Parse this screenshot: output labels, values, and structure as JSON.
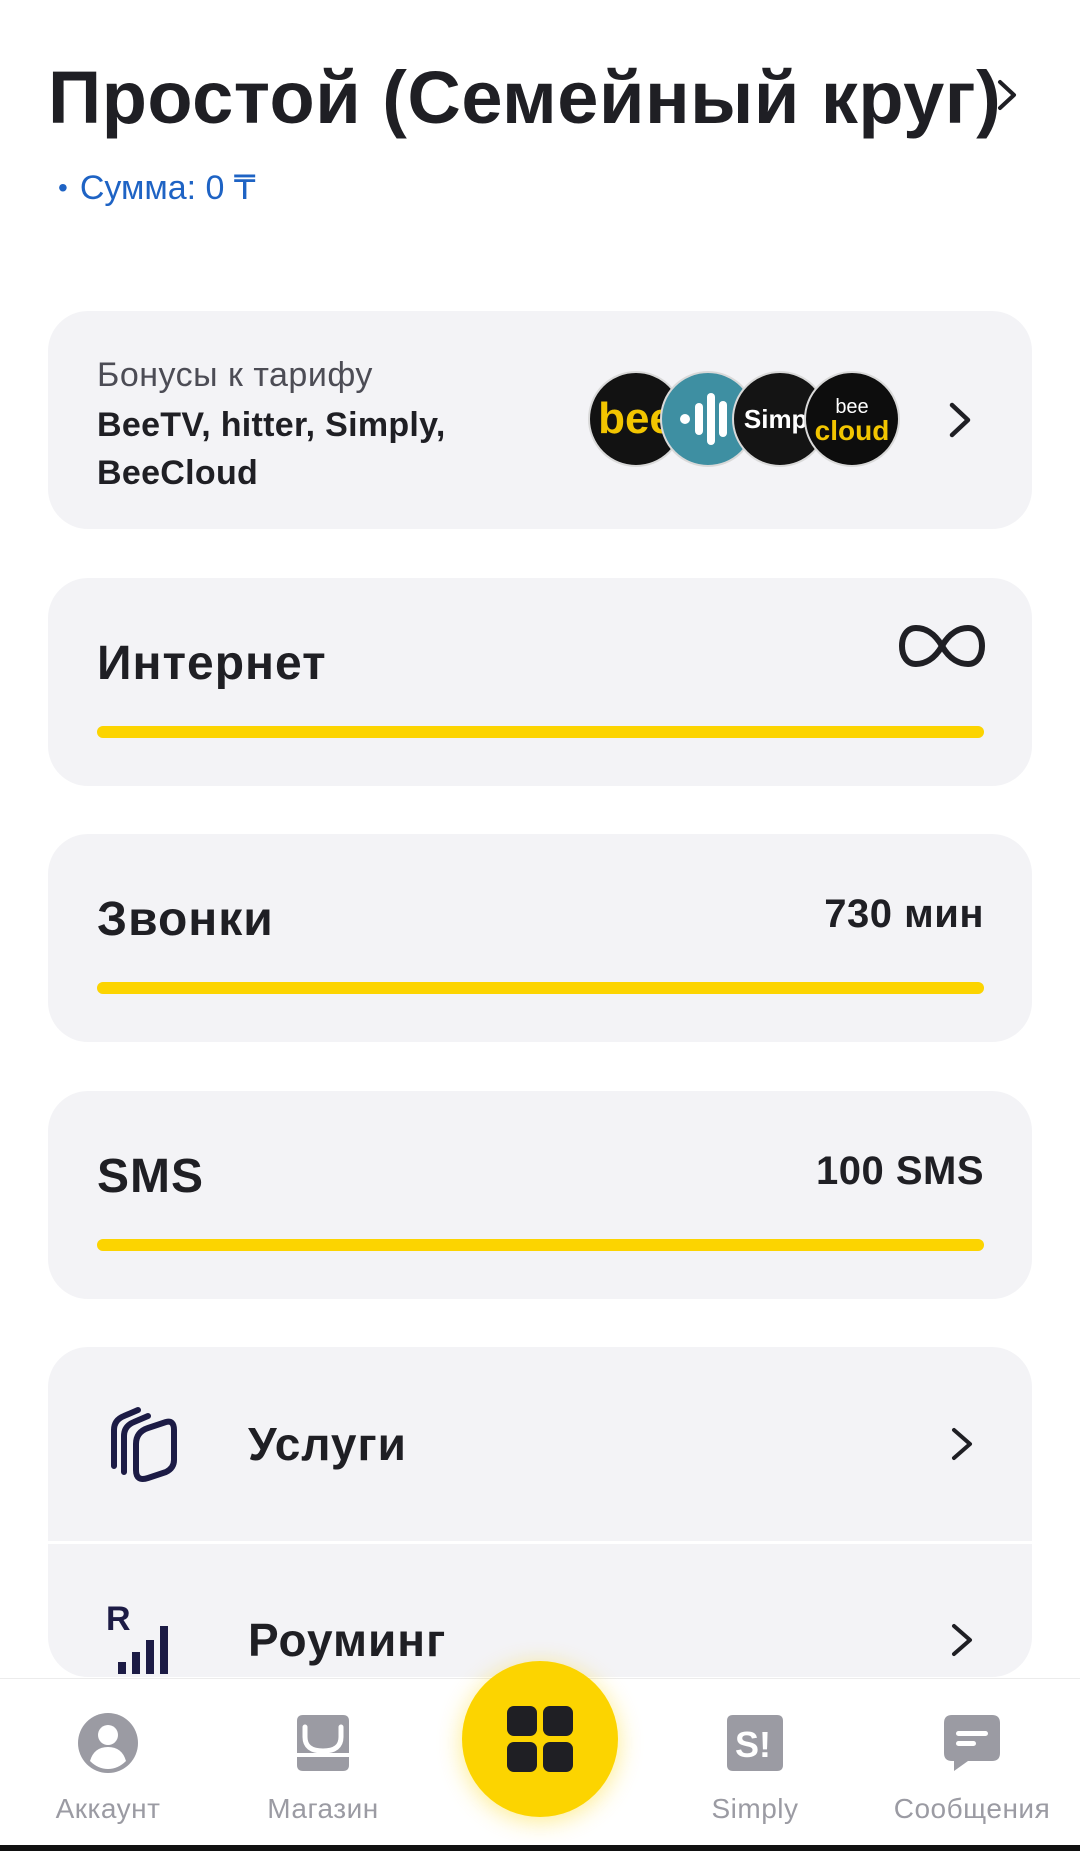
{
  "header": {
    "title": "Простой (Семейный круг)",
    "sum": "Сумма: 0 ₸",
    "sum_bullet": "•"
  },
  "bonuses": {
    "subtitle": "Бонусы к тарифу",
    "list": "BeeTV, hitter, Simply, BeeCloud",
    "logos": [
      {
        "icon": "beetv-logo",
        "text": "bee"
      },
      {
        "icon": "hitter-logo",
        "text": ""
      },
      {
        "icon": "simply-logo",
        "text": "Simp!"
      },
      {
        "icon": "beecloud-logo",
        "text_top": "bee",
        "text": "cloud"
      }
    ]
  },
  "usage": [
    {
      "label": "Интернет",
      "value": "",
      "icon": "infinity-icon",
      "fill_percent": 100
    },
    {
      "label": "Звонки",
      "value": "730 мин",
      "fill_percent": 100
    },
    {
      "label": "SMS",
      "value": "100 SMS",
      "fill_percent": 100
    }
  ],
  "menu": [
    {
      "label": "Услуги",
      "icon": "services-icon"
    },
    {
      "label": "Роуминг",
      "icon": "roaming-icon"
    }
  ],
  "nav": {
    "account": "Аккаунт",
    "shop": "Магазин",
    "simply": "Simply",
    "messages": "Сообщения"
  },
  "colors": {
    "accent": "#fcd400",
    "link": "#1e63c4",
    "card": "#f3f3f6",
    "nav_inactive": "#9b9ba3"
  }
}
